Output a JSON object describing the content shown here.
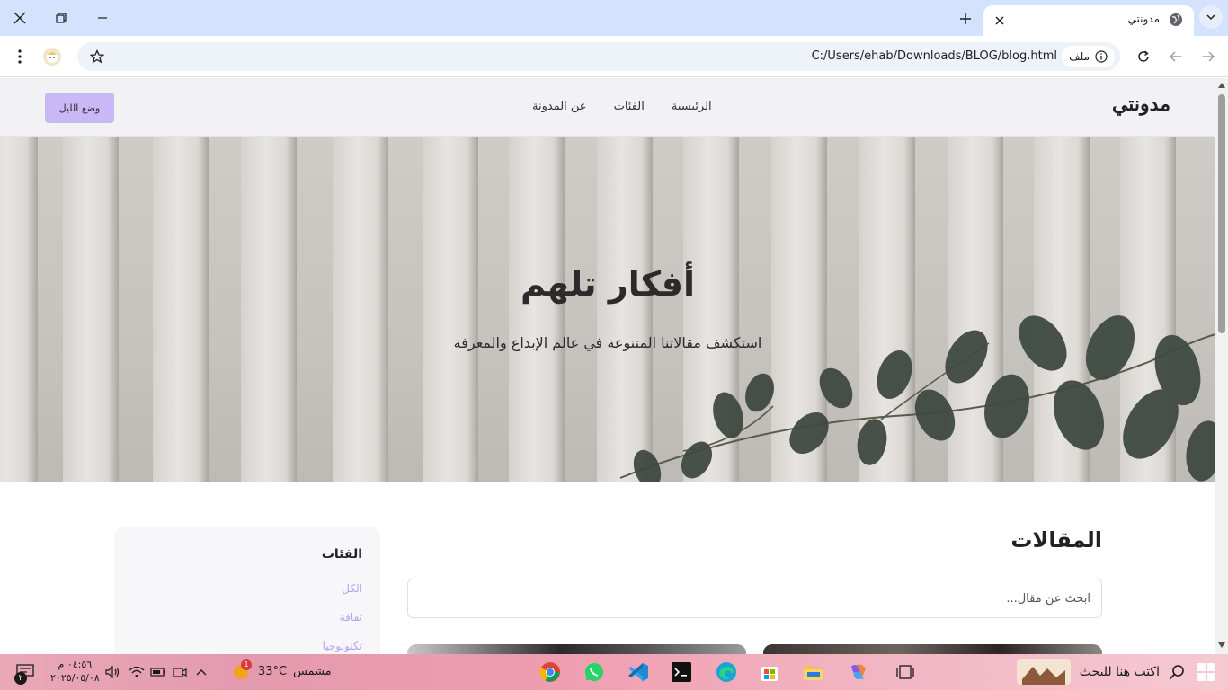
{
  "browser": {
    "tab_title": "مدونتي",
    "url": "C:/Users/ehab/Downloads/BLOG/blog.html",
    "site_chip": "ملف"
  },
  "page": {
    "logo": "مدونتي",
    "nav": [
      "الرئيسية",
      "الفئات",
      "عن المدونة"
    ],
    "dark_mode_button": "وضع الليل",
    "hero": {
      "title": "أفكار تلهم",
      "subtitle": "استكشف مقالاتنا المتنوعة في عالم الإبداع والمعرفة"
    },
    "posts_title": "المقالات",
    "search_placeholder": "ابحث عن مقال...",
    "sidebar": {
      "title": "الفئات",
      "items": [
        "الكل",
        "ثقافة",
        "تكنولوجيا"
      ]
    }
  },
  "taskbar": {
    "search_placeholder": "اكتب هنا للبحث",
    "weather_label": "مشمس",
    "temperature": "33°C",
    "weather_badge": "1",
    "time": "٠٤:٥٦ م",
    "date": "٢٠٢٥/٠٥/٠٨",
    "notification_count": "٢"
  },
  "colors": {
    "accent": "#c9b8f5",
    "category_link": "#b7a3ee",
    "tab_strip": "#d3e3fd"
  }
}
